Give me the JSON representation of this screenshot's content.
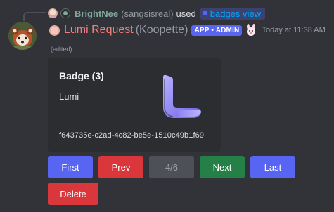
{
  "reply": {
    "name": "BrightNee",
    "tag": "(sangsisreal)",
    "used": "used",
    "command": "badges view"
  },
  "message": {
    "username": "Lumi Request",
    "usertag": "(Koopette)",
    "app_badge": "APP • ADMIN",
    "timestamp": "Today at 11:38 AM",
    "edited": "(edited)"
  },
  "embed": {
    "title": "Badge (3)",
    "description": "Lumi",
    "footer": "f643735e-c2ad-4c82-be5e-1510c49b1f69",
    "thumbnail_icon": "lumi-logo-icon"
  },
  "buttons": {
    "first": "First",
    "prev": "Prev",
    "page": "4/6",
    "next": "Next",
    "last": "Last",
    "delete": "Delete"
  },
  "colors": {
    "background": "#313338",
    "embed": "#2b2d31",
    "blurple": "#5865f2",
    "danger": "#da373c",
    "success": "#248046",
    "secondary": "#4e5058",
    "username": "#f47f7c",
    "reply_name": "#80a89c"
  }
}
